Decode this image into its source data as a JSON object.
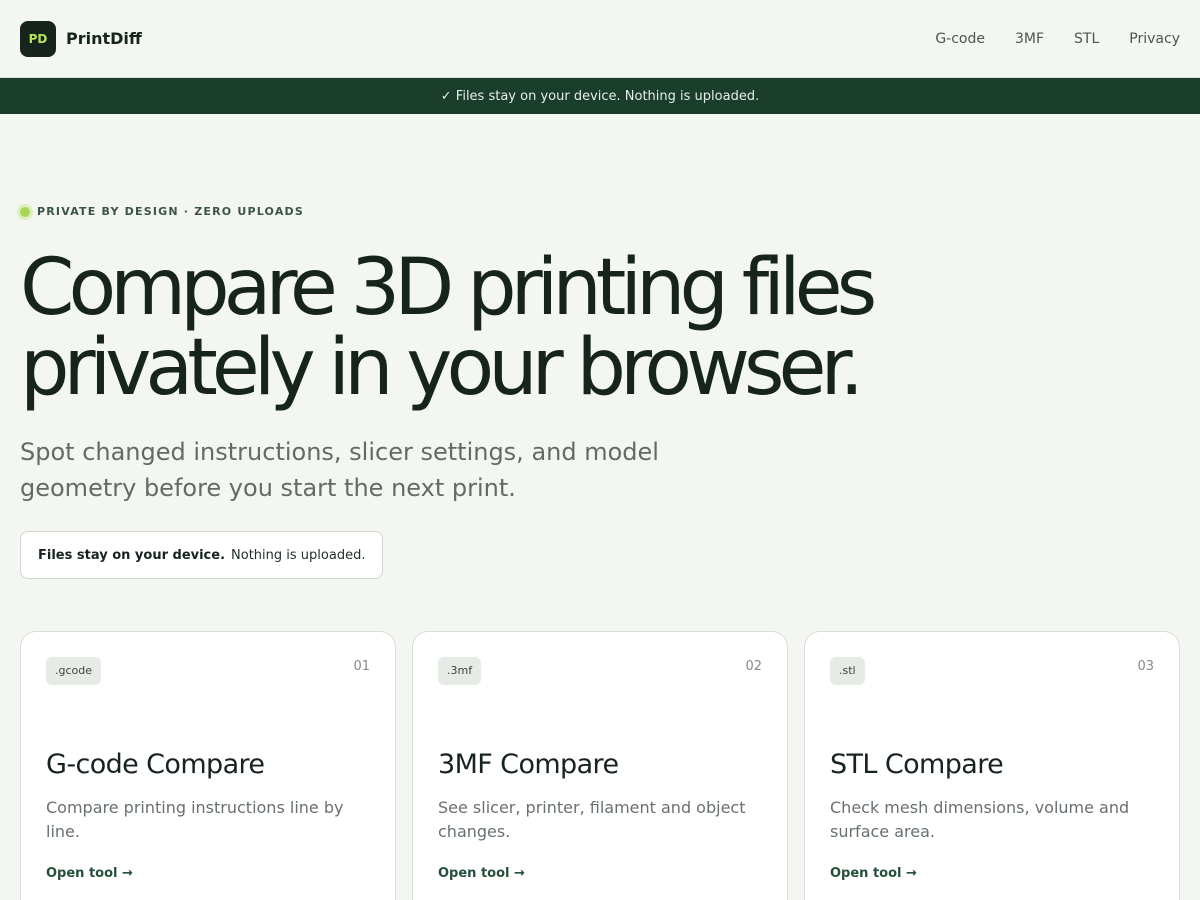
{
  "header": {
    "logo_text": "PD",
    "brand_name": "PrintDiff",
    "nav": [
      "G-code",
      "3MF",
      "STL",
      "Privacy"
    ]
  },
  "banner": {
    "text": "✓ Files stay on your device. Nothing is uploaded."
  },
  "hero": {
    "eyebrow": "PRIVATE BY DESIGN · ZERO UPLOADS",
    "title_line1": "Compare 3D printing files",
    "title_line2": "privately in your browser.",
    "subtitle": "Spot changed instructions, slicer settings, and model geometry before you start the next print.",
    "notice_strong": "Files stay on your device.",
    "notice_rest": "Nothing is uploaded."
  },
  "cards": [
    {
      "ext": ".gcode",
      "number": "01",
      "title": "G-code Compare",
      "description": "Compare printing instructions line by line.",
      "link": "Open tool →"
    },
    {
      "ext": ".3mf",
      "number": "02",
      "title": "3MF Compare",
      "description": "See slicer, printer, filament and object changes.",
      "link": "Open tool →"
    },
    {
      "ext": ".stl",
      "number": "03",
      "title": "STL Compare",
      "description": "Check mesh dimensions, volume and surface area.",
      "link": "Open tool →"
    }
  ],
  "colors": {
    "background": "#f4f6f2",
    "banner": "#1a3d2c",
    "accent_green": "#a9d653",
    "text_dark": "#17231d"
  }
}
